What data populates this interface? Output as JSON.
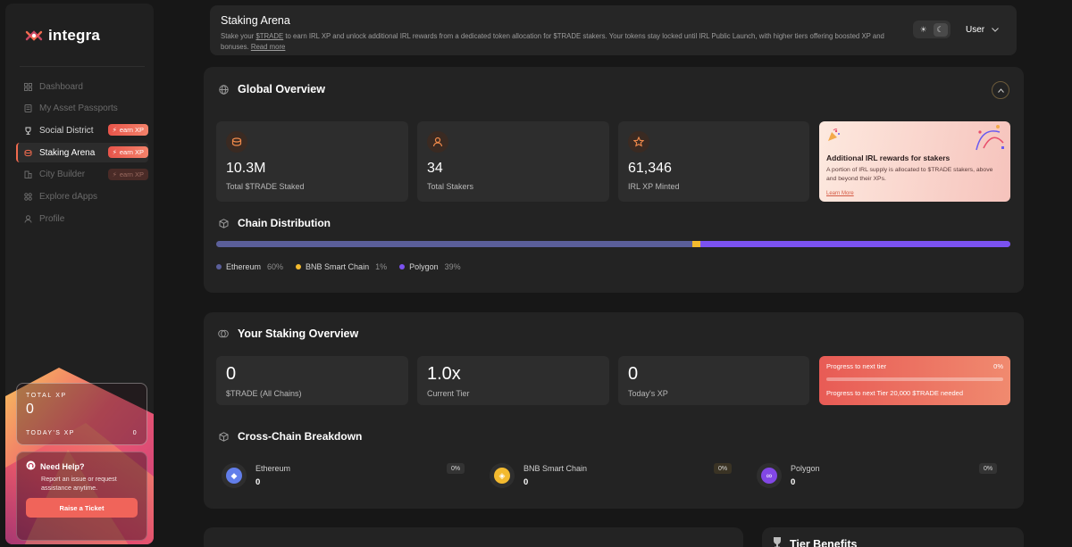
{
  "brand": {
    "name": "integra"
  },
  "sidebar": {
    "items": [
      {
        "label": "Dashboard",
        "icon": "grid-icon"
      },
      {
        "label": "My Asset Passports",
        "icon": "passport-icon"
      },
      {
        "label": "Social District",
        "icon": "trophy-icon",
        "badge": "earn XP"
      },
      {
        "label": "Staking Arena",
        "icon": "coins-icon",
        "badge": "earn XP",
        "active": true
      },
      {
        "label": "City Builder",
        "icon": "building-icon",
        "badge": "earn XP"
      },
      {
        "label": "Explore dApps",
        "icon": "apps-icon"
      },
      {
        "label": "Profile",
        "icon": "user-icon"
      }
    ],
    "xp_card": {
      "total_label": "TOTAL XP",
      "total_value": "0",
      "today_label": "TODAY'S XP",
      "today_value": "0"
    },
    "help": {
      "title": "Need Help?",
      "text": "Report an issue or request assistance anytime.",
      "button": "Raise a Ticket"
    }
  },
  "header": {
    "title": "Staking Arena",
    "desc_prefix": "Stake your",
    "desc_link": "$TRADE",
    "desc_suffix": "to earn IRL XP and unlock additional IRL rewards from a dedicated token allocation for $TRADE stakers. Your tokens stay locked until IRL Public Launch, with higher tiers offering boosted XP and bonuses.",
    "read_more": "Read more",
    "user_label": "User"
  },
  "global_overview": {
    "title": "Global Overview",
    "stats": [
      {
        "value": "10.3M",
        "label": "Total $TRADE Staked",
        "icon": "coins-icon"
      },
      {
        "value": "34",
        "label": "Total Stakers",
        "icon": "user-icon"
      },
      {
        "value": "61,346",
        "label": "IRL XP Minted",
        "icon": "star-icon"
      }
    ],
    "promo": {
      "title": "Additional IRL rewards for stakers",
      "text": "A portion of IRL supply is allocated to $TRADE stakers, above and beyond their XPs.",
      "link": "Learn More"
    },
    "chain_distribution": {
      "title": "Chain Distribution",
      "chains": [
        {
          "name": "Ethereum",
          "pct_label": "60%",
          "pct": 60,
          "color": "#5b5f9a"
        },
        {
          "name": "BNB Smart Chain",
          "pct_label": "1%",
          "pct": 1,
          "color": "#f3ba2f"
        },
        {
          "name": "Polygon",
          "pct_label": "39%",
          "pct": 39,
          "color": "#7b52f0"
        }
      ]
    }
  },
  "your_staking": {
    "title": "Your Staking Overview",
    "stats": [
      {
        "value": "0",
        "label": "$TRADE (All Chains)"
      },
      {
        "value": "1.0x",
        "label": "Current Tier"
      },
      {
        "value": "0",
        "label": "Today's XP"
      }
    ],
    "progress": {
      "label": "Progress to next tier",
      "pct_label": "0%",
      "pct": 0,
      "note": "Progress to next Tier 20,000 $TRADE needed"
    }
  },
  "cross_chain": {
    "title": "Cross-Chain Breakdown",
    "chains": [
      {
        "name": "Ethereum",
        "value": "0",
        "pct": "0%",
        "icon": "ethereum-icon",
        "color": "#627eea"
      },
      {
        "name": "BNB Smart Chain",
        "value": "0",
        "pct": "0%",
        "icon": "bnb-icon",
        "color": "#f3ba2f"
      },
      {
        "name": "Polygon",
        "value": "0",
        "pct": "0%",
        "icon": "polygon-icon",
        "color": "#8247e5"
      }
    ]
  },
  "tier_benefits": {
    "title": "Tier Benefits"
  }
}
